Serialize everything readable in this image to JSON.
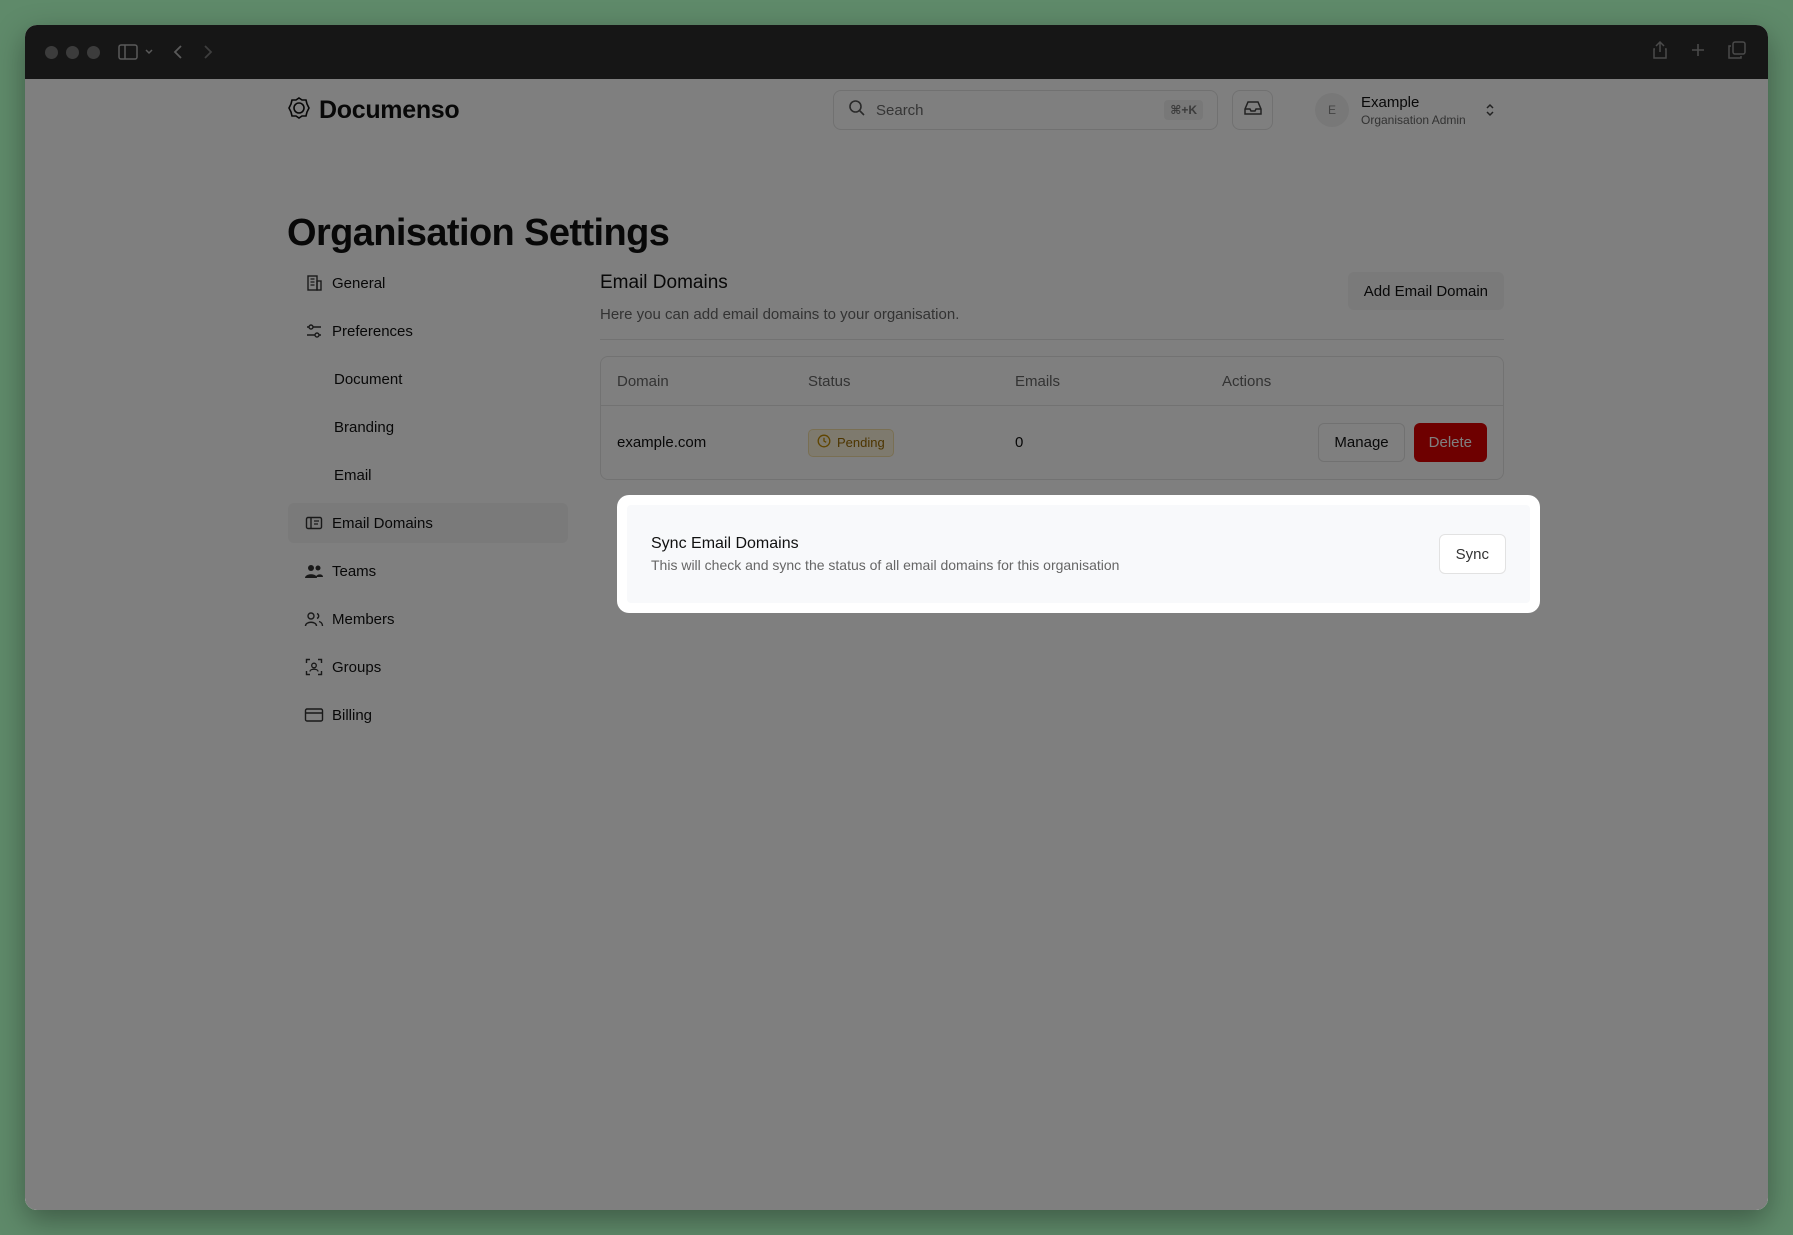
{
  "header": {
    "brand": "Documenso",
    "search_placeholder": "Search",
    "search_shortcut": "⌘+K",
    "account": {
      "initial": "E",
      "name": "Example",
      "role": "Organisation Admin"
    }
  },
  "page_title": "Organisation Settings",
  "sidebar": {
    "items": [
      {
        "label": "General",
        "icon": "building-icon"
      },
      {
        "label": "Preferences",
        "icon": "sliders-icon"
      },
      {
        "label": "Document"
      },
      {
        "label": "Branding"
      },
      {
        "label": "Email"
      },
      {
        "label": "Email Domains",
        "icon": "mail-domain-icon",
        "active": true
      },
      {
        "label": "Teams",
        "icon": "users-icon"
      },
      {
        "label": "Members",
        "icon": "members-icon"
      },
      {
        "label": "Groups",
        "icon": "group-icon"
      },
      {
        "label": "Billing",
        "icon": "credit-card-icon"
      }
    ]
  },
  "section": {
    "title": "Email Domains",
    "description": "Here you can add email domains to your organisation.",
    "add_button": "Add Email Domain"
  },
  "table": {
    "columns": [
      "Domain",
      "Status",
      "Emails",
      "Actions"
    ],
    "rows": [
      {
        "domain": "example.com",
        "status": "Pending",
        "emails": "0",
        "manage": "Manage",
        "delete": "Delete"
      }
    ]
  },
  "sync": {
    "title": "Sync Email Domains",
    "description": "This will check and sync the status of all email domains for this organisation",
    "button": "Sync"
  },
  "colors": {
    "danger": "#dc0000",
    "pending_badge_bg": "#fdf4dc",
    "pending_badge_text": "#9a6a00"
  }
}
